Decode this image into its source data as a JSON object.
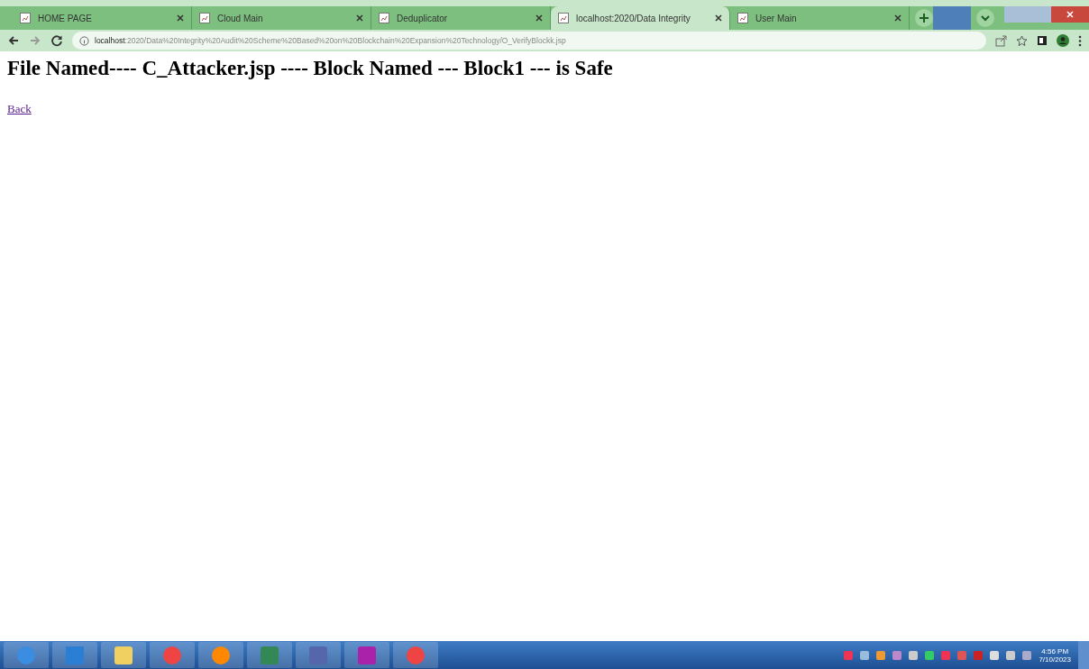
{
  "browser": {
    "tabs": [
      {
        "title": "HOME PAGE",
        "selected": false
      },
      {
        "title": "Cloud Main",
        "selected": false
      },
      {
        "title": "Deduplicator",
        "selected": false
      },
      {
        "title": "localhost:2020/Data Integrity",
        "selected": true
      },
      {
        "title": "User Main",
        "selected": false
      }
    ],
    "url_host": "localhost",
    "url_rest": ":2020/Data%20Integrity%20Audit%20Scheme%20Based%20on%20Blockchain%20Expansion%20Technology/O_VerifyBlockk.jsp"
  },
  "page": {
    "heading": "File Named---- C_Attacker.jsp ---- Block Named --- Block1 --- is Safe",
    "link": "Back"
  },
  "taskbar": {
    "time": "4:56 PM",
    "date": "7/10/2023"
  }
}
